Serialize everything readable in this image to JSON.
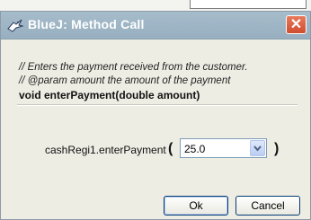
{
  "window": {
    "title": "BlueJ:  Method Call",
    "close_symbol": "✕"
  },
  "icons": {
    "app": "bluej-bird-icon",
    "close": "close-icon",
    "dropdown": "chevron-down-icon"
  },
  "method": {
    "comment_line1": "// Enters the payment received from the customer.",
    "comment_line2": "// @param amount the amount of the payment",
    "signature": "void enterPayment(double amount)"
  },
  "call": {
    "receiver_label": "cashRegi1.enterPayment",
    "open_paren": "(",
    "close_paren": ")",
    "argument_value": "25.0"
  },
  "buttons": {
    "ok_label": "Ok",
    "cancel_label": "Cancel"
  },
  "colors": {
    "titlebar": "#a6bccb",
    "close_button": "#cf4c2e",
    "dialog_bg": "#eeede4"
  }
}
